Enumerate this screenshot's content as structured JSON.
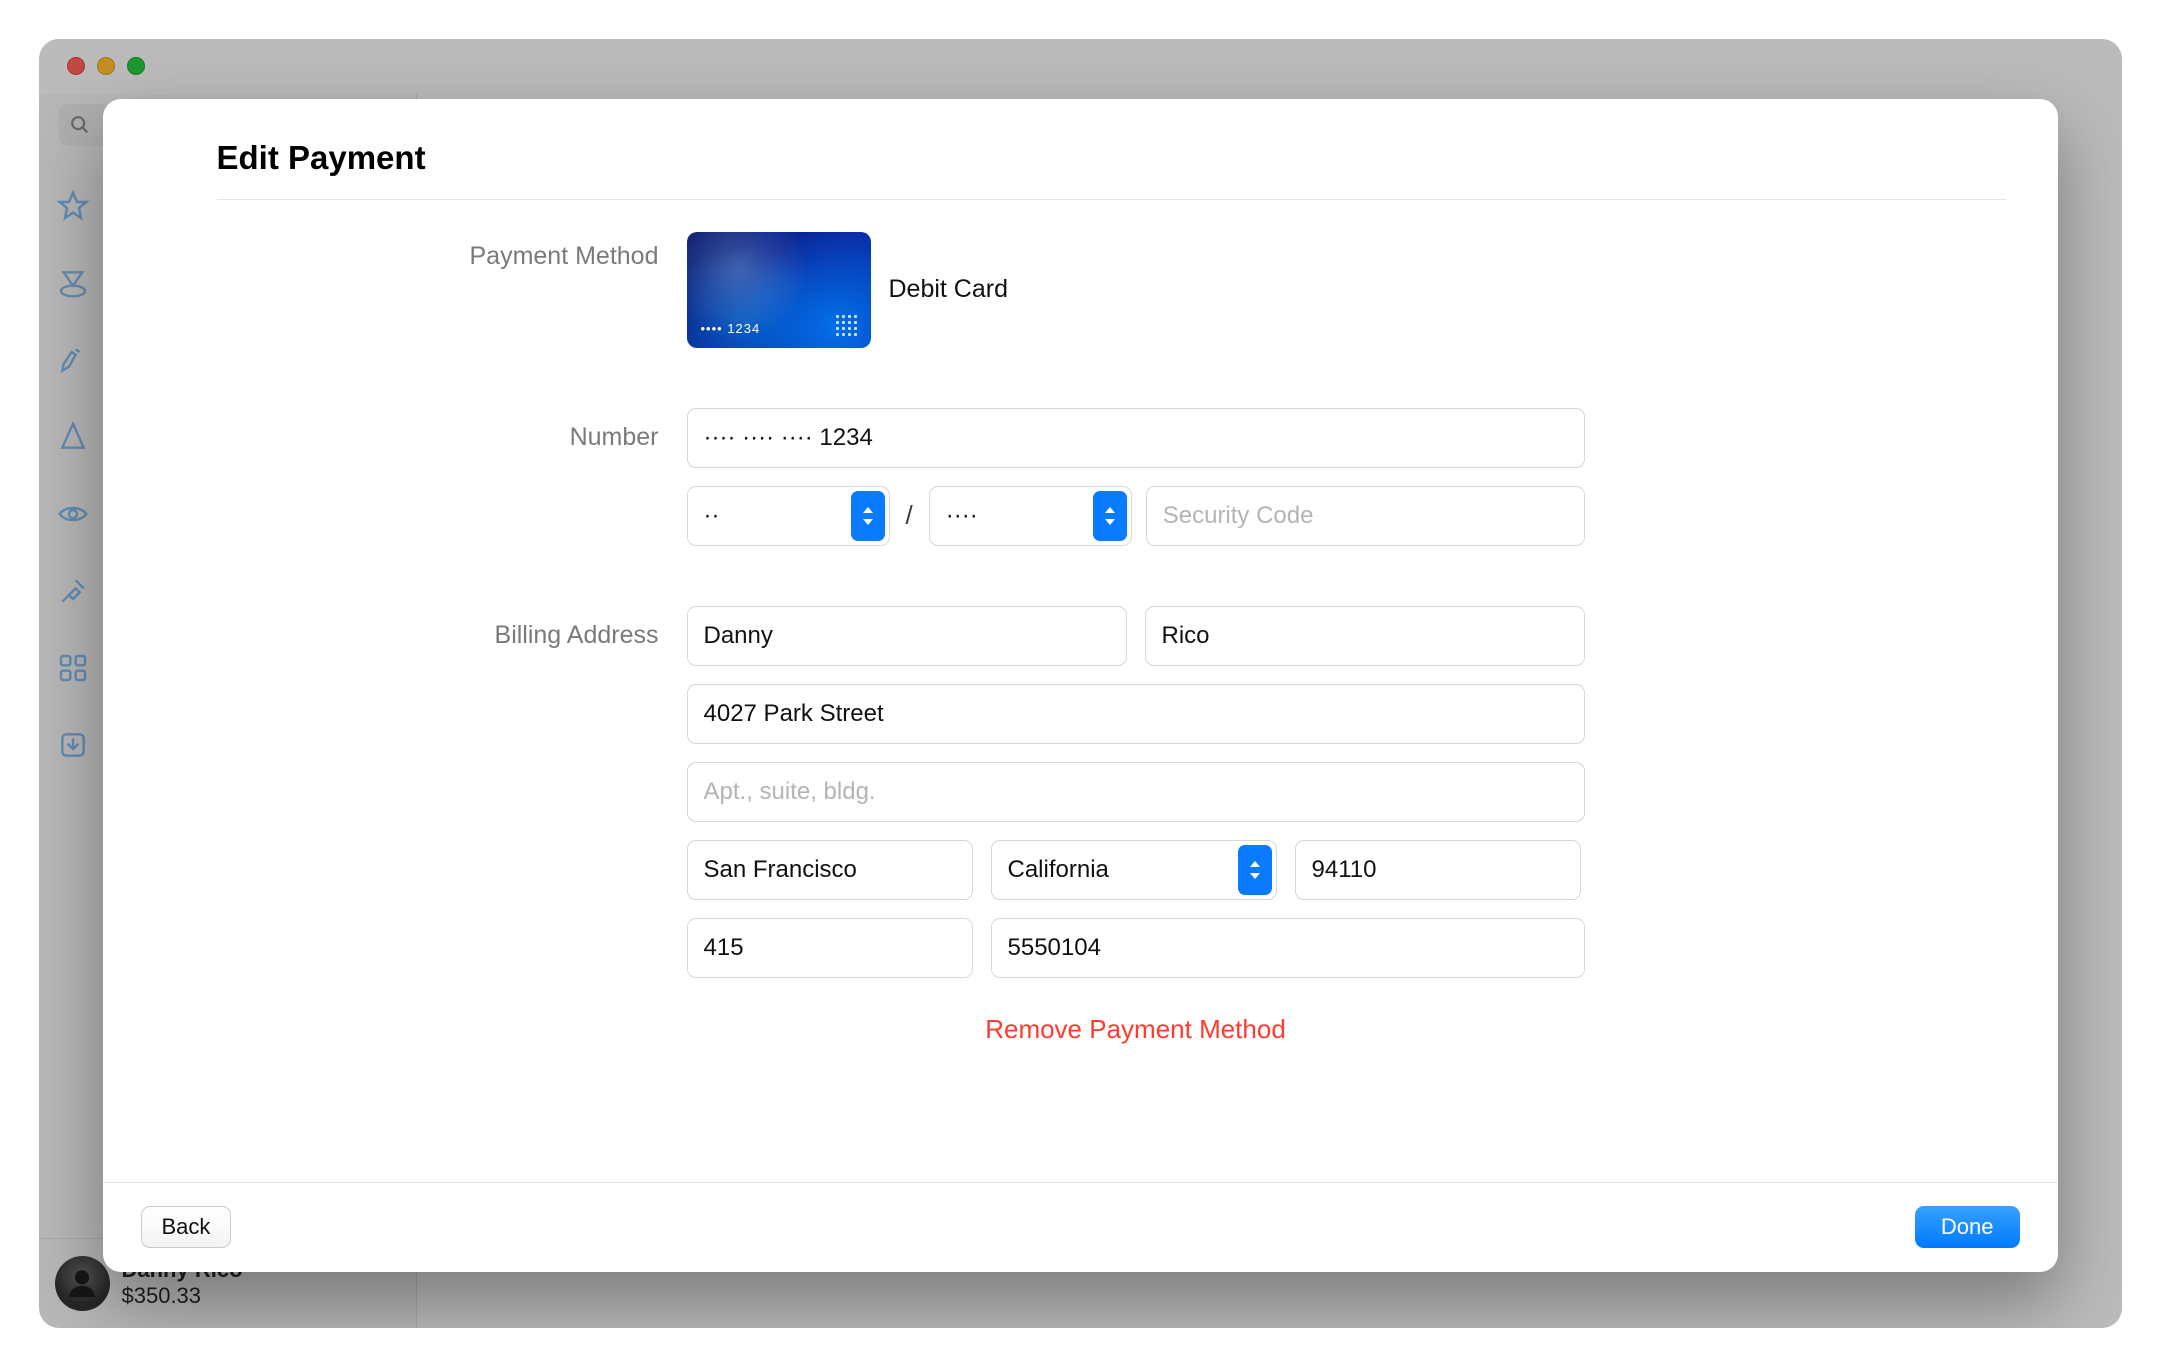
{
  "sheet": {
    "title": "Edit Payment",
    "labels": {
      "payment_method": "Payment Method",
      "number": "Number",
      "billing_address": "Billing Address"
    },
    "payment_type": "Debit Card",
    "card_last4_display": "•••• 1234",
    "number_value": "···· ···· ···· 1234",
    "exp_month_display": "··",
    "exp_year_display": "····",
    "exp_separator": "/",
    "cvc_placeholder": "Security Code",
    "billing": {
      "first_name": "Danny",
      "last_name": "Rico",
      "street1": "4027 Park Street",
      "street2_placeholder": "Apt., suite, bldg.",
      "city": "San Francisco",
      "state": "California",
      "zip": "94110",
      "phone_area": "415",
      "phone_number": "5550104"
    },
    "remove_label": "Remove Payment Method",
    "footer": {
      "back": "Back",
      "done": "Done"
    }
  },
  "app_behind": {
    "user_name": "Danny Rico",
    "user_balance": "$350.33"
  },
  "colors": {
    "accent": "#007aff",
    "destructive": "#ff3b30"
  }
}
